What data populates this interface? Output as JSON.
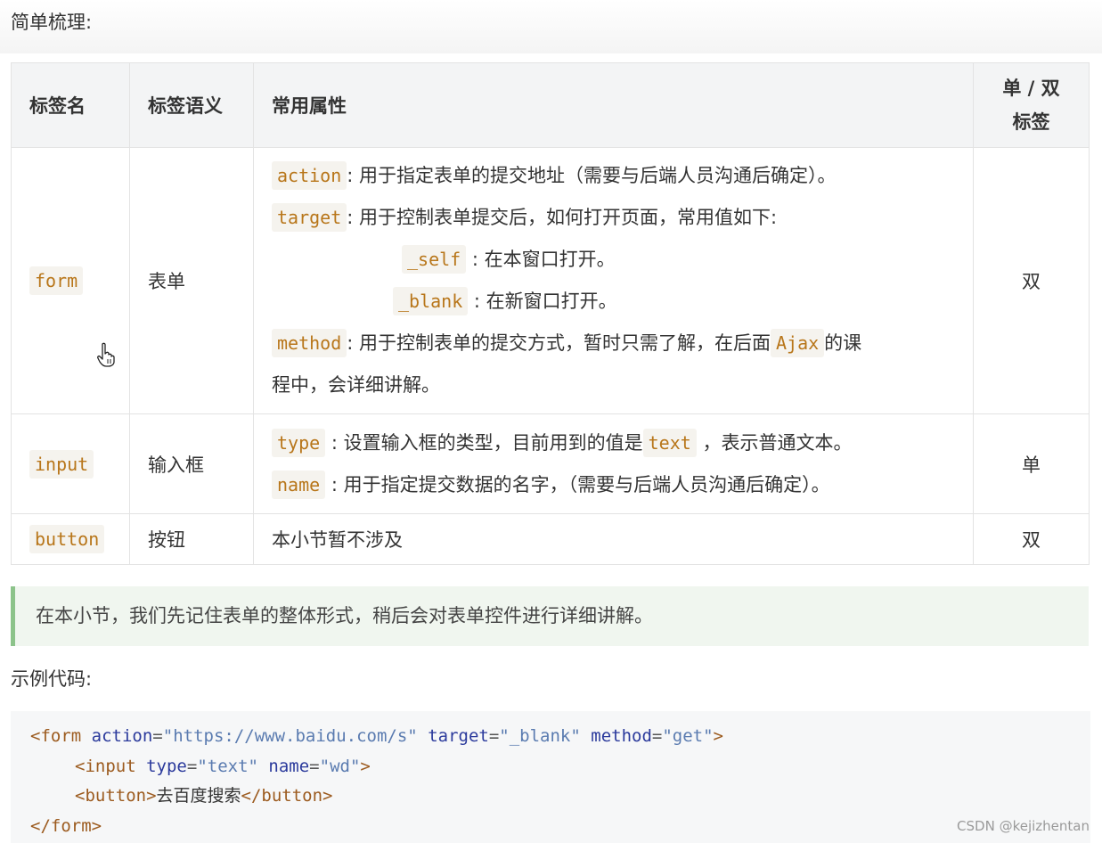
{
  "headings": {
    "summary": "简单梳理:",
    "example": "示例代码:"
  },
  "table": {
    "headers": [
      "标签名",
      "标签语义",
      "常用属性",
      "单 / 双",
      "标签"
    ],
    "rows": [
      {
        "tag": "form",
        "meaning": "表单",
        "kind": "双",
        "attrs": {
          "action_code": "action",
          "action_text": ": 用于指定表单的提交地址（需要与后端人员沟通后确定）。",
          "target_code": "target",
          "target_text": ": 用于控制表单提交后，如何打开页面，常用值如下:",
          "self_code": "_self",
          "self_text": " : 在本窗口打开。",
          "blank_code": "_blank",
          "blank_text": " : 在新窗口打开。",
          "method_code": "method",
          "method_text_a": ": 用于控制表单的提交方式，暂时只需了解，在后面",
          "ajax_code": "Ajax",
          "method_text_b": "的课",
          "method_text_c": "程中，会详细讲解。"
        }
      },
      {
        "tag": "input",
        "meaning": "输入框",
        "kind": "单",
        "attrs": {
          "type_code": "type",
          "type_text_a": " : 设置输入框的类型，目前用到的值是",
          "text_code": "text",
          "type_text_b": " ，表示普通文本。",
          "name_code": "name",
          "name_text": " : 用于指定提交数据的名字，（需要与后端人员沟通后确定）。"
        }
      },
      {
        "tag": "button",
        "meaning": "按钮",
        "kind": "双",
        "attrs_text": "本小节暂不涉及"
      }
    ]
  },
  "note": "在本小节，我们先记住表单的整体形式，稍后会对表单控件进行详细讲解。",
  "code_sample": {
    "l1": {
      "open": "<form",
      "a1": "action",
      "v1": "\"https://www.baidu.com/s\"",
      "a2": "target",
      "v2": "\"_blank\"",
      "a3": "method",
      "v3": "\"get\"",
      "close": ">"
    },
    "l2": {
      "open": "<input",
      "a1": "type",
      "v1": "\"text\"",
      "a2": "name",
      "v2": "\"wd\"",
      "close": ">"
    },
    "l3": {
      "open": "<button>",
      "text": "去百度搜索",
      "close": "</button>"
    },
    "l4": {
      "close": "</form>"
    }
  },
  "watermark": "CSDN @kejizhentan",
  "colors": {
    "code_inline": "#b8761a",
    "note_border": "#8cc38a",
    "note_bg": "#f0f6ef",
    "header_bg": "#f3f4f5"
  },
  "icons": [
    "hand-cursor-icon"
  ]
}
